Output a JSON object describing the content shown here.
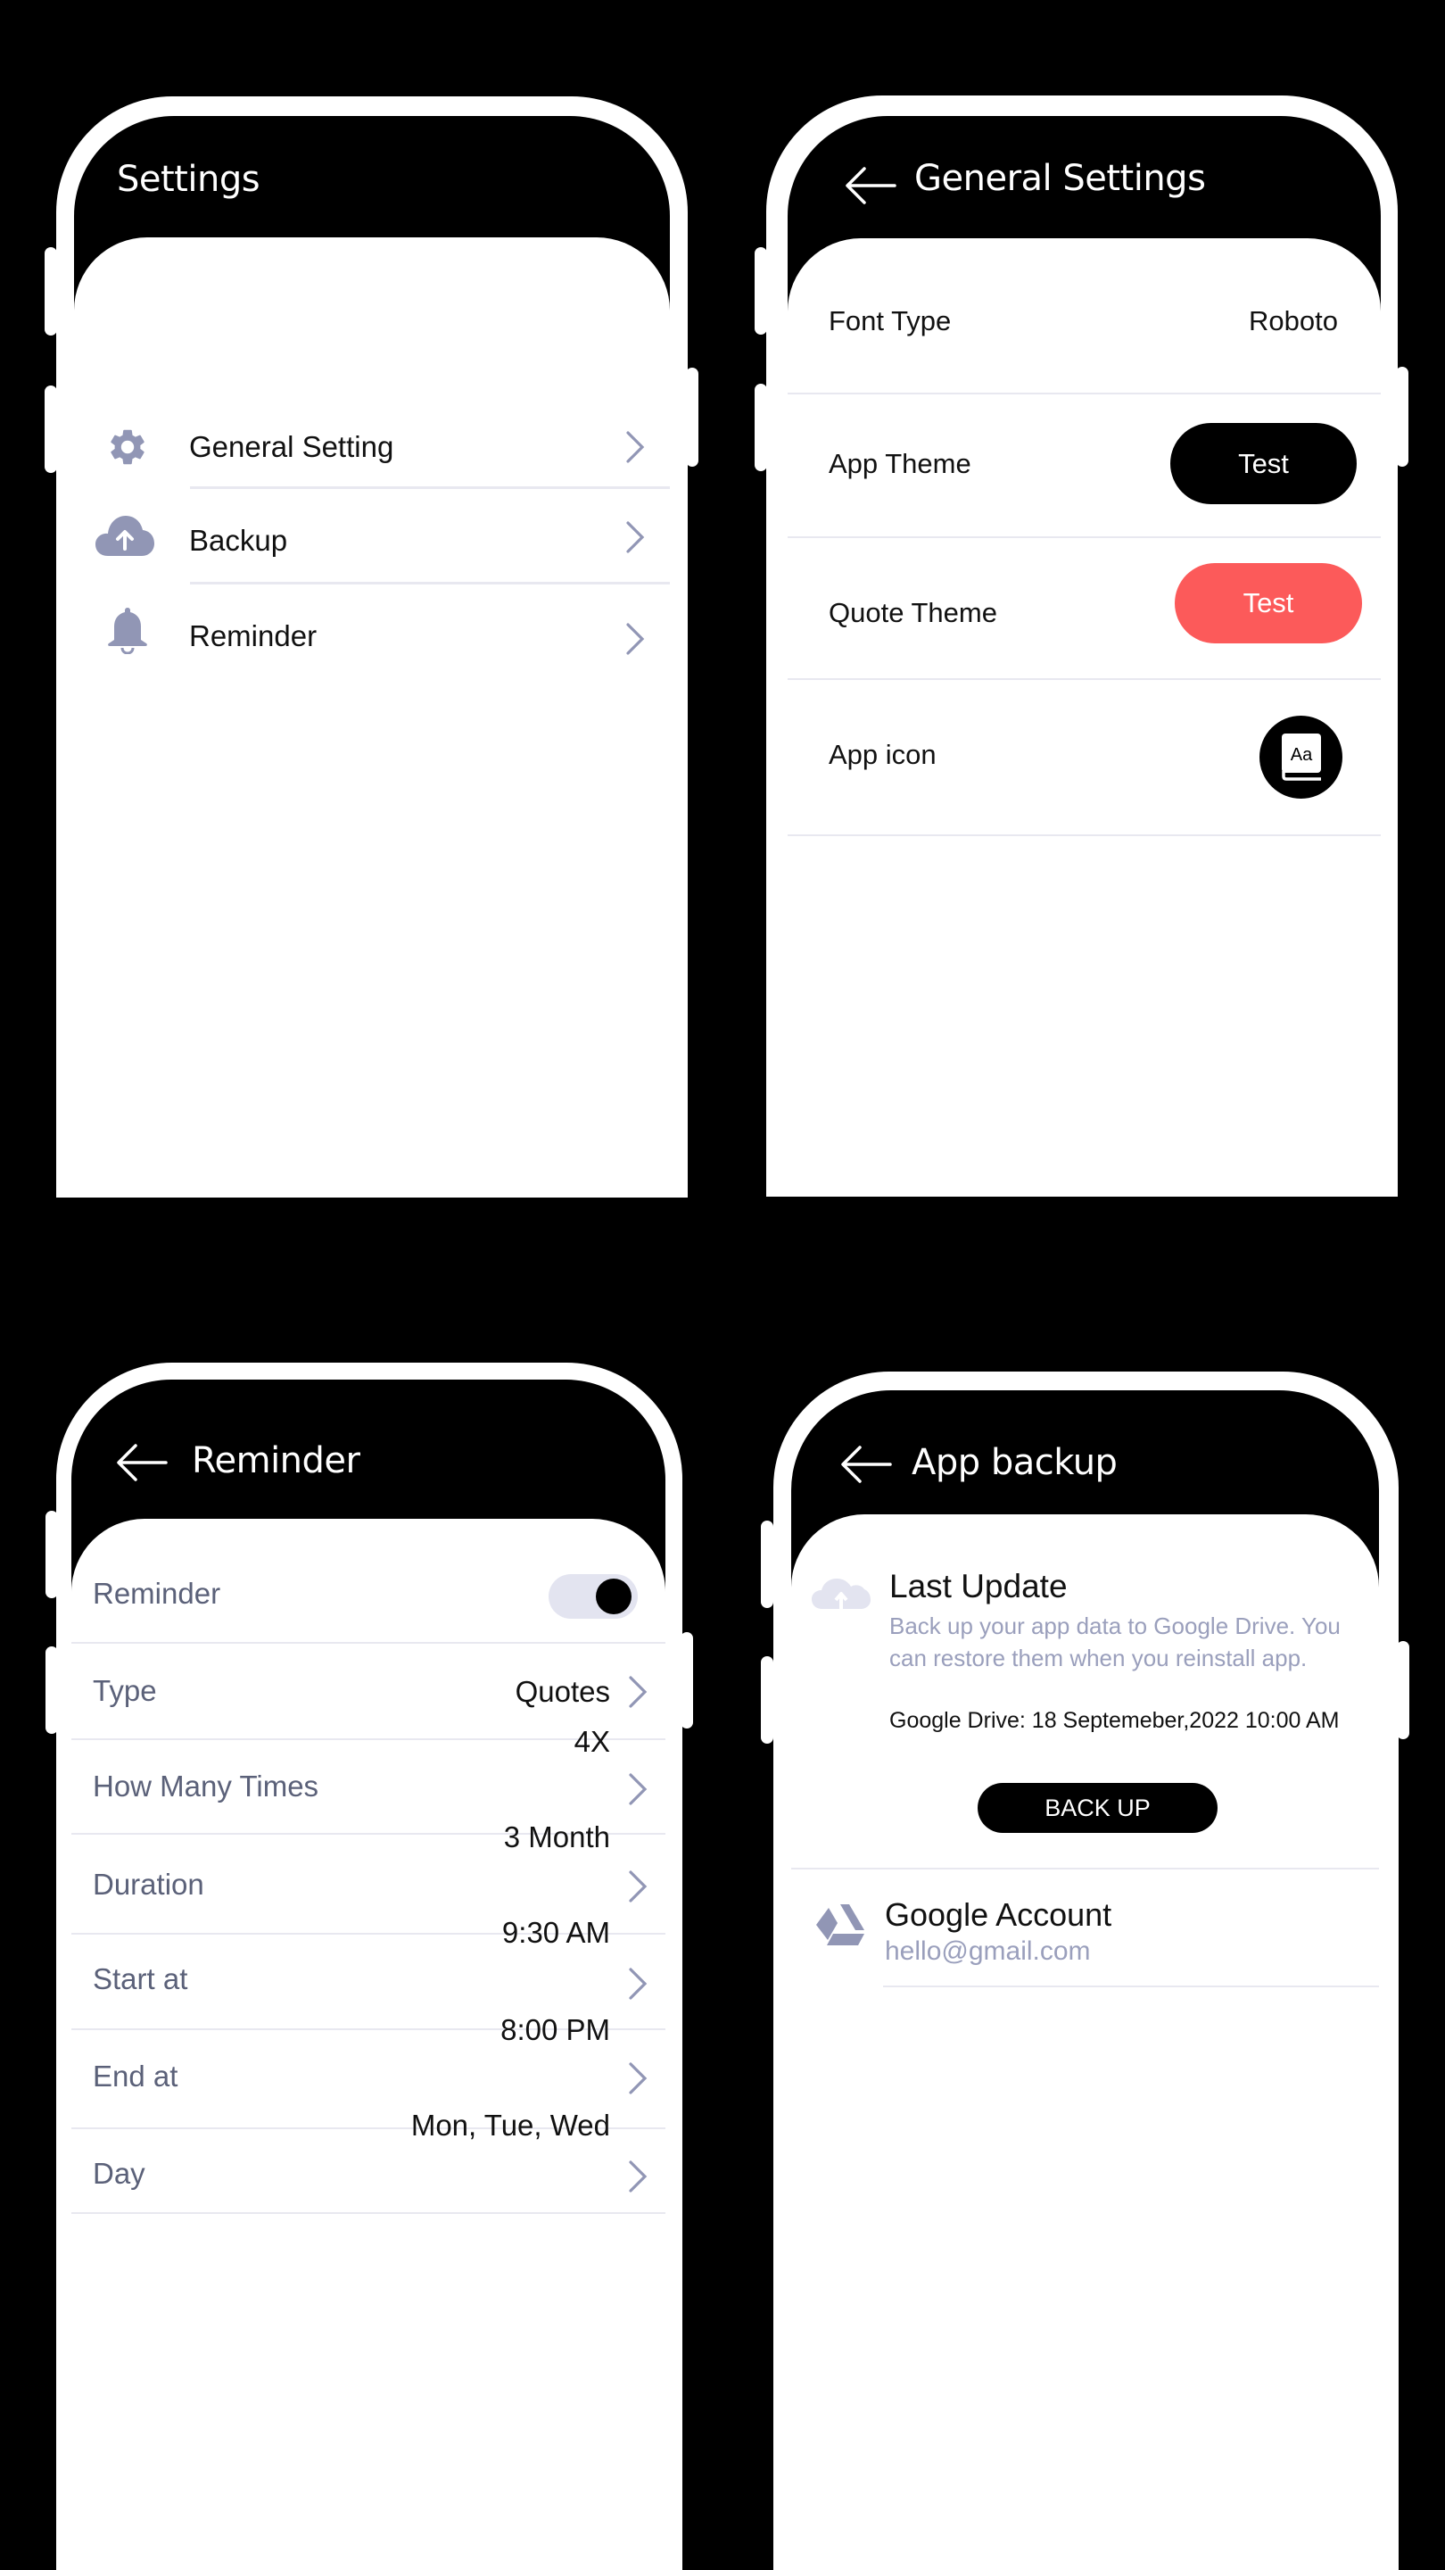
{
  "colors": {
    "background": "#000000",
    "icon_muted": "#9196b5",
    "label_muted": "#5b6179",
    "accent_red": "#fc5a5a",
    "toggle_track": "#e3e4f0",
    "description": "#9a9fbc"
  },
  "settings_screen": {
    "title": "Settings",
    "items": [
      {
        "icon": "gear-icon",
        "label": "General Setting"
      },
      {
        "icon": "cloud-upload-icon",
        "label": "Backup"
      },
      {
        "icon": "bell-icon",
        "label": "Reminder"
      }
    ]
  },
  "general_settings_screen": {
    "title": "General Settings",
    "back_icon": "arrow-left-icon",
    "rows": [
      {
        "label": "Font Type",
        "value": "Roboto"
      },
      {
        "label": "App Theme",
        "button": "Test"
      },
      {
        "label": "Quote Theme",
        "button": "Test"
      },
      {
        "label": "App icon",
        "icon": "book-aa-icon",
        "icon_text": "Aa"
      }
    ]
  },
  "reminder_screen": {
    "title": "Reminder",
    "back_icon": "arrow-left-icon",
    "toggle": {
      "label": "Reminder",
      "on": true
    },
    "rows": [
      {
        "label": "Type",
        "value": "Quotes"
      },
      {
        "label": "How Many Times",
        "value": "4X"
      },
      {
        "label": "Duration",
        "value": "3 Month"
      },
      {
        "label": "Start at",
        "value": "9:30 AM"
      },
      {
        "label": "End at",
        "value": "8:00 PM"
      },
      {
        "label": "Day",
        "value": "Mon, Tue, Wed"
      }
    ]
  },
  "backup_screen": {
    "title": "App backup",
    "back_icon": "arrow-left-icon",
    "last_update": {
      "heading": "Last Update",
      "description_line1": "Back up your app data to Google Drive. You",
      "description_line2": "can restore them when you reinstall app.",
      "drive_status": "Google Drive: 18 Septemeber,2022 10:00 AM",
      "button": "BACK UP"
    },
    "account": {
      "heading": "Google Account",
      "email": "hello@gmail.com"
    }
  }
}
